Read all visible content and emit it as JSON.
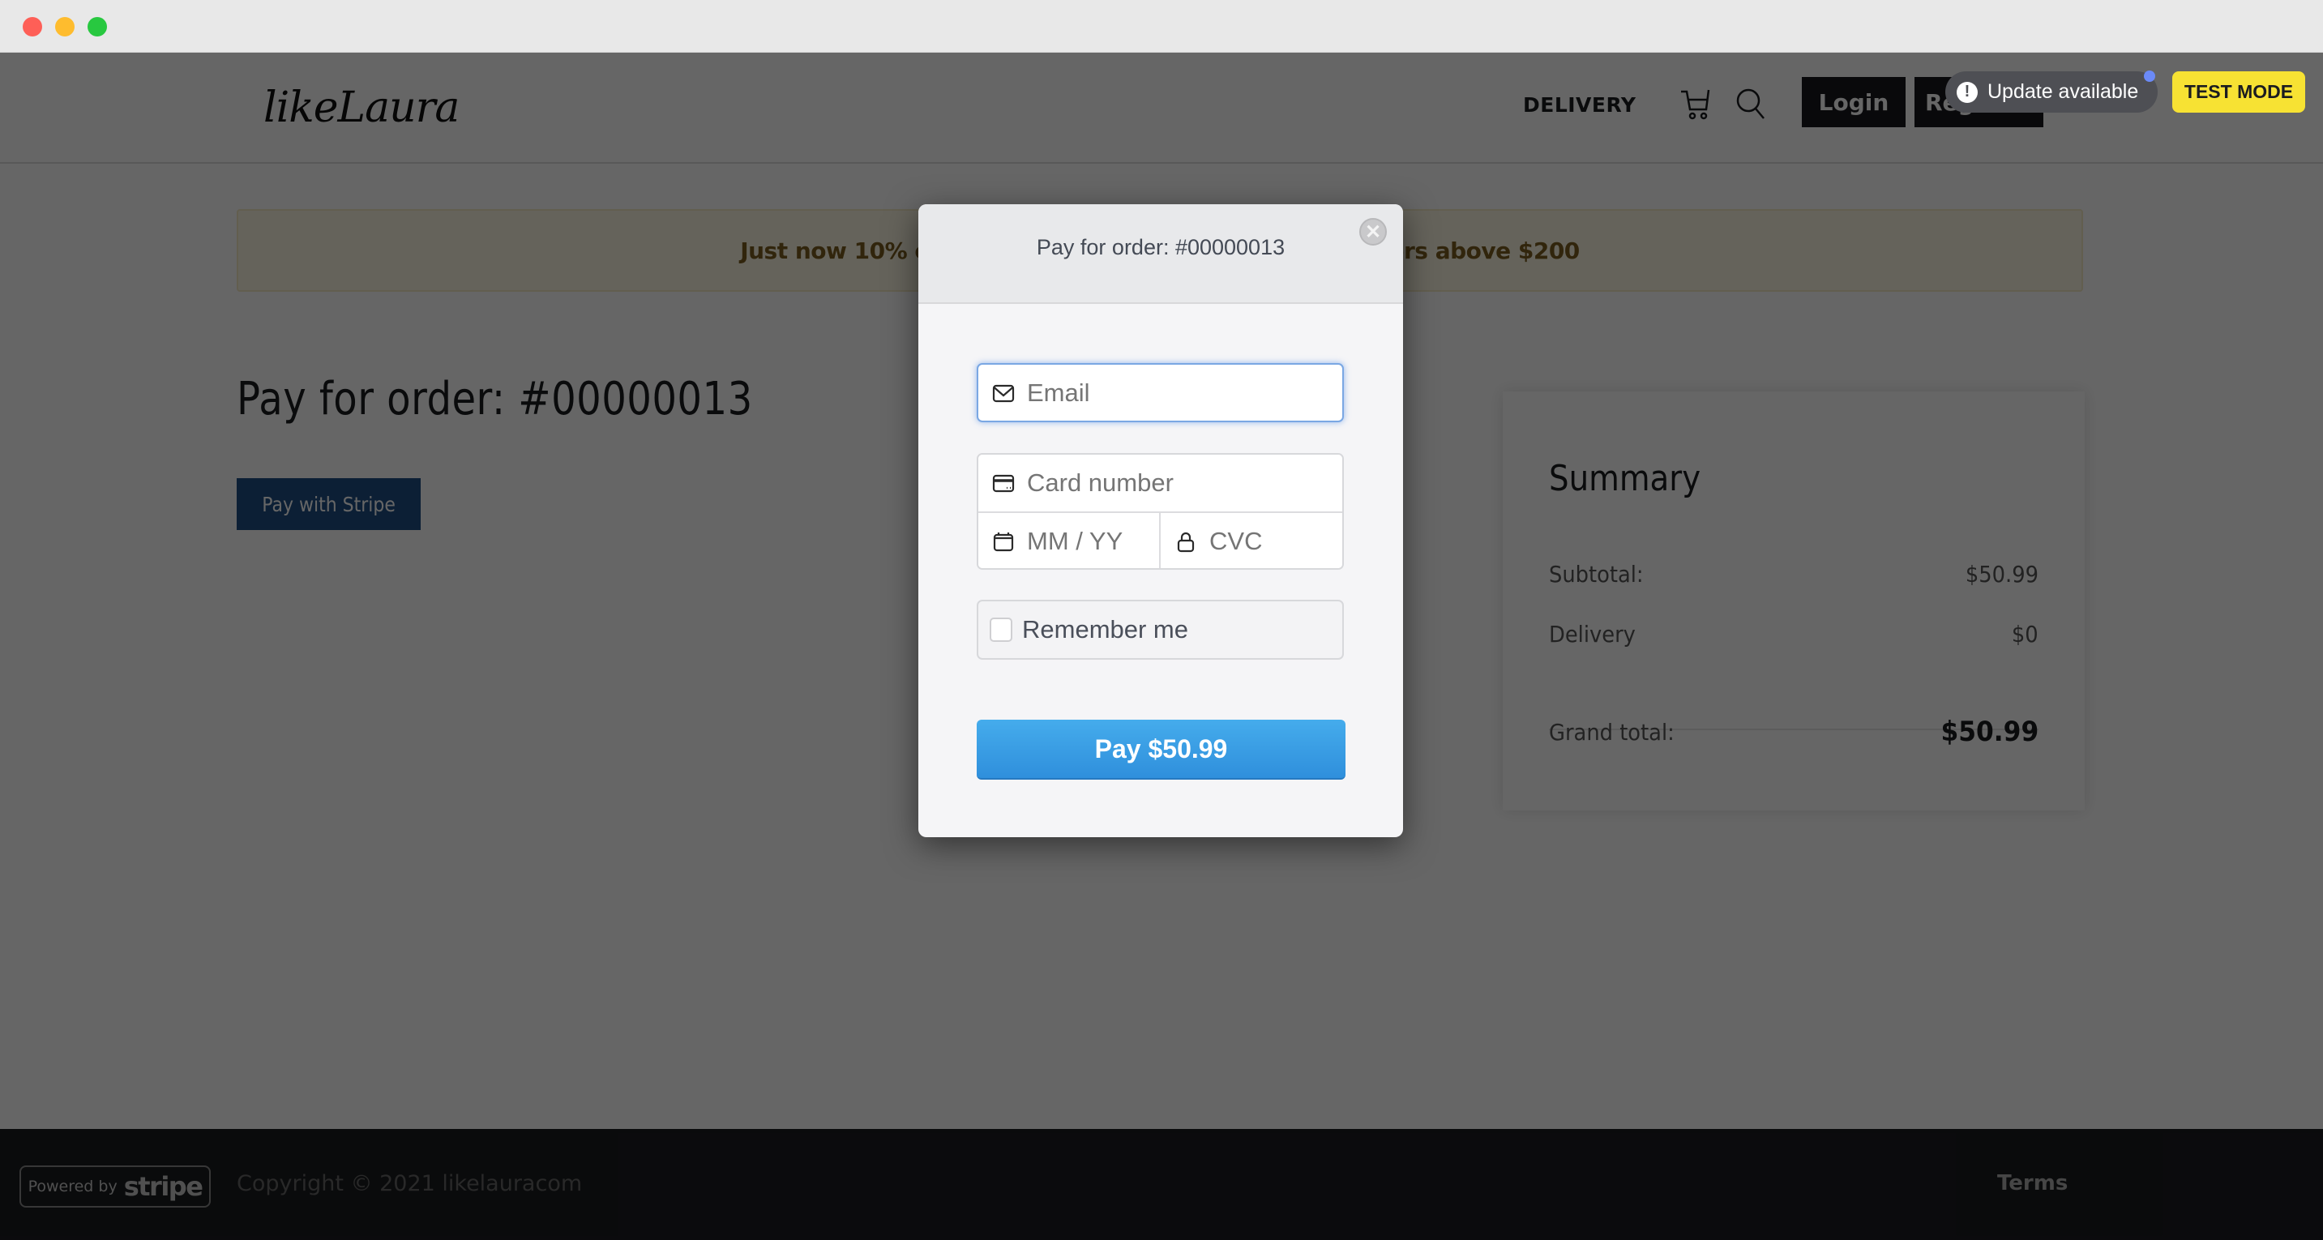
{
  "window": {
    "controls": [
      "close",
      "minimize",
      "maximize"
    ]
  },
  "header": {
    "logo": "likeLaura",
    "nav": [
      {
        "label": "DELIVERY"
      }
    ],
    "icons": [
      "cart-icon",
      "search-icon"
    ],
    "login_label": "Login",
    "register_label": "Register"
  },
  "overlay_badges": {
    "update_label": "Update available",
    "update_icon": "!",
    "test_mode_label": "TEST MODE"
  },
  "banner": {
    "text": "Just now 10% off everything! Discounts apply to orders above $200"
  },
  "main": {
    "title": "Pay for order: #00000013",
    "pay_with_stripe_label": "Pay with Stripe"
  },
  "summary": {
    "title": "Summary",
    "rows": [
      {
        "label": "Subtotal:",
        "value": "$50.99"
      },
      {
        "label": "Delivery",
        "value": "$0"
      }
    ],
    "grand_total_label": "Grand total:",
    "grand_total_value": "$50.99"
  },
  "modal": {
    "title": "Pay for order: #00000013",
    "close_glyph": "✕",
    "email_placeholder": "Email",
    "email_value": "",
    "card_number_placeholder": "Card number",
    "expiry_placeholder": "MM / YY",
    "cvc_placeholder": "CVC",
    "remember_label": "Remember me",
    "remember_checked": false,
    "pay_label": "Pay $50.99"
  },
  "footer": {
    "powered_by": "Powered by",
    "stripe_word": "stripe",
    "copyright": "Copyright © 2021 likelauracom",
    "terms_label": "Terms"
  },
  "colors": {
    "brand_dark": "#17181d",
    "stripe_blue": "#2f8fdc",
    "test_mode_yellow": "#f7e233",
    "banner_bg": "#fdf8e4",
    "pay_with_stripe_bg": "#1f4f86"
  }
}
